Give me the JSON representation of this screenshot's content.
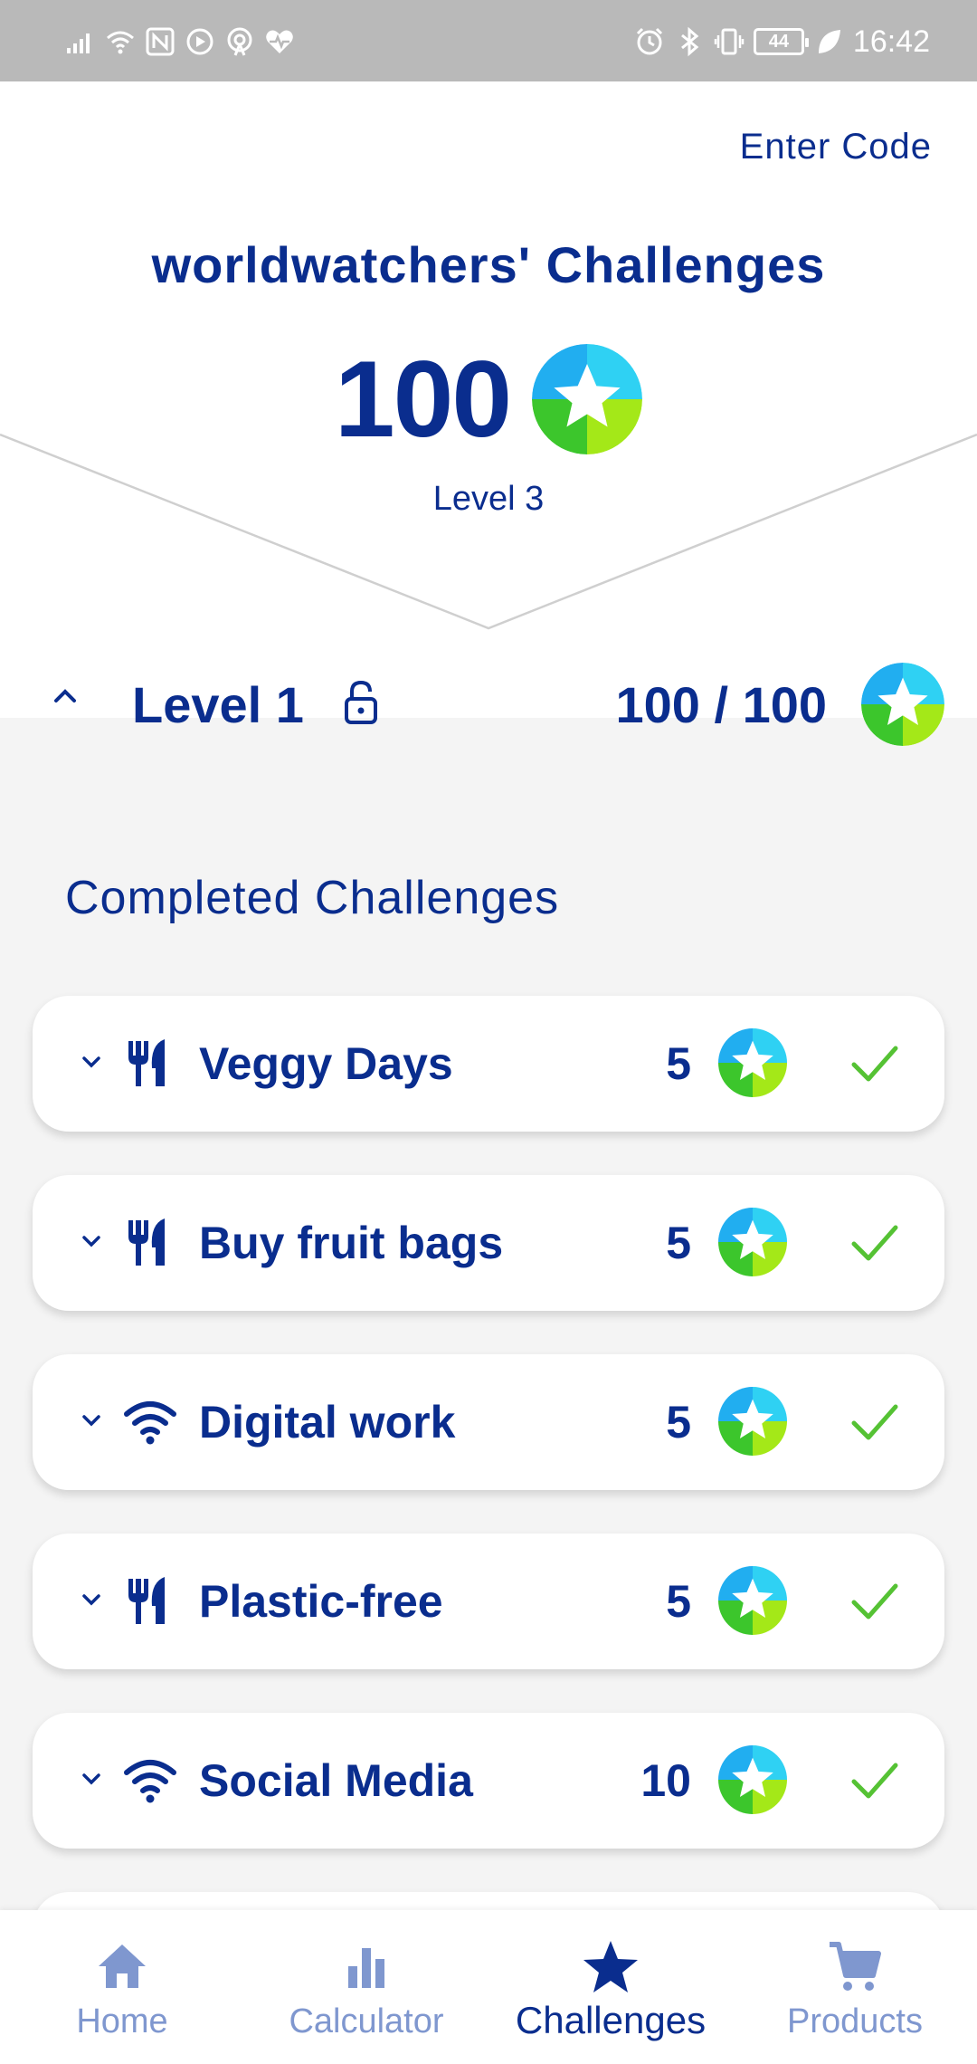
{
  "status_bar": {
    "time": "16:42",
    "battery": "44",
    "left_icons": [
      "signal-icon",
      "wifi-icon",
      "nfc-icon",
      "media-icon",
      "hotspot-icon",
      "health-icon"
    ],
    "right_icons": [
      "alarm-icon",
      "bluetooth-icon",
      "vibrate-icon",
      "battery-icon",
      "leaf-icon"
    ]
  },
  "header": {
    "enter_code_label": "Enter Code",
    "title": "worldwatchers' Challenges",
    "points": "100",
    "level_label": "Level 3"
  },
  "level": {
    "title": "Level 1",
    "progress": "100 / 100",
    "lock_icon": "lock-open-icon"
  },
  "completed": {
    "section_title": "Completed Challenges",
    "items": [
      {
        "title": "Veggy Days",
        "points": "5",
        "category_icon": "cutlery-icon"
      },
      {
        "title": "Buy fruit bags",
        "points": "5",
        "category_icon": "cutlery-icon"
      },
      {
        "title": "Digital work",
        "points": "5",
        "category_icon": "wifi-icon"
      },
      {
        "title": "Plastic-free",
        "points": "5",
        "category_icon": "cutlery-icon"
      },
      {
        "title": "Social Media",
        "points": "10",
        "category_icon": "wifi-icon"
      }
    ]
  },
  "bottom_nav": {
    "items": [
      {
        "label": "Home",
        "icon": "home-icon",
        "active": false
      },
      {
        "label": "Calculator",
        "icon": "bar-chart-icon",
        "active": false
      },
      {
        "label": "Challenges",
        "icon": "star-icon",
        "active": true
      },
      {
        "label": "Products",
        "icon": "cart-icon",
        "active": false
      }
    ]
  },
  "colors": {
    "brand_blue": "#0a2d8e",
    "check_green": "#55c234",
    "inactive_nav": "#7f97cf",
    "background": "#f4f4f4"
  }
}
